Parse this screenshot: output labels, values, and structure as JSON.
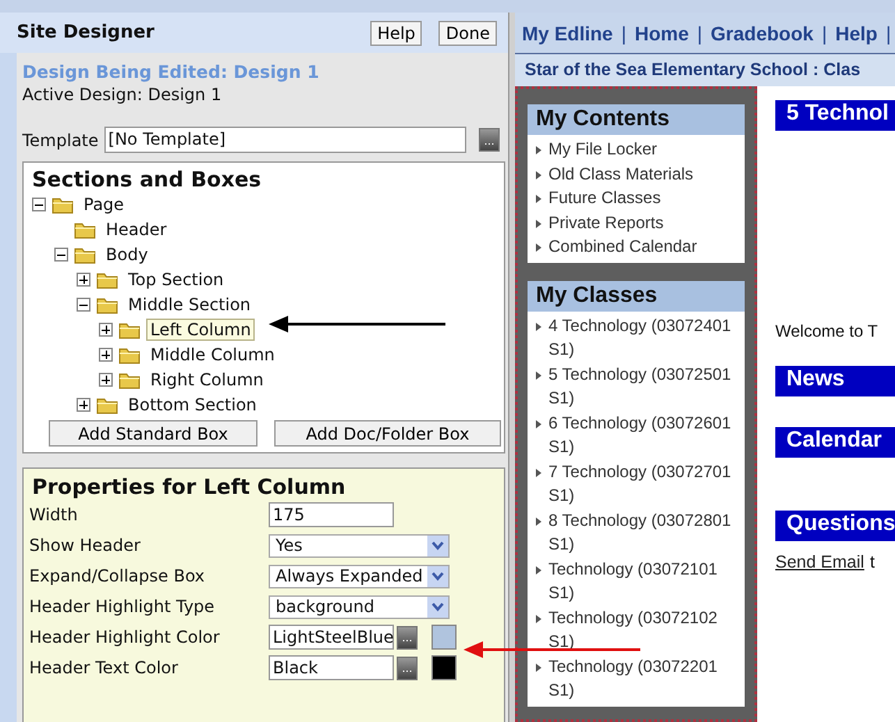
{
  "designer": {
    "title": "Site Designer",
    "buttons": [
      "Help",
      "Done"
    ],
    "design_being_edited": "Design Being Edited: Design 1",
    "active_design": "Active Design: Design 1",
    "template": {
      "label": "Template",
      "value": "[No Template]",
      "button": "..."
    },
    "sections": {
      "title": "Sections and Boxes",
      "tree": [
        {
          "label": "Page",
          "expanded": true,
          "selected": false,
          "children": [
            {
              "label": "Header",
              "selected": false
            },
            {
              "label": "Body",
              "expanded": true,
              "selected": false,
              "children": [
                {
                  "label": "Top Section",
                  "expanded": false,
                  "selected": false
                },
                {
                  "label": "Middle Section",
                  "expanded": true,
                  "selected": false,
                  "children": [
                    {
                      "label": "Left Column",
                      "expanded": false,
                      "selected": true
                    },
                    {
                      "label": "Middle Column",
                      "expanded": false,
                      "selected": false
                    },
                    {
                      "label": "Right Column",
                      "expanded": false,
                      "selected": false
                    }
                  ]
                },
                {
                  "label": "Bottom Section",
                  "expanded": false,
                  "selected": false
                }
              ]
            }
          ]
        }
      ],
      "buttons": [
        "Add Standard Box",
        "Add Doc/Folder Box"
      ]
    },
    "properties": {
      "title": "Properties for Left Column",
      "rows": [
        {
          "kind": "text",
          "label": "Width",
          "value": "175"
        },
        {
          "kind": "select",
          "label": "Show Header",
          "value": "Yes"
        },
        {
          "kind": "select",
          "label": "Expand/Collapse Box",
          "value": "Always Expanded"
        },
        {
          "kind": "select",
          "label": "Header Highlight Type",
          "value": "background"
        },
        {
          "kind": "color",
          "label": "Header Highlight Color",
          "value": "LightSteelBlue",
          "button": "...",
          "color": "#b0c4de"
        },
        {
          "kind": "color",
          "label": "Header Text Color",
          "value": "Black",
          "button": "...",
          "color": "#000000"
        }
      ]
    }
  },
  "preview": {
    "nav": [
      "My Edline",
      "|",
      "Home",
      "|",
      "Gradebook",
      "|",
      "Help",
      "|"
    ],
    "school": "Star of the Sea Elementary School : Clas",
    "boxes": [
      {
        "title": "My Contents",
        "items": [
          "My File Locker",
          "Old Class Materials",
          "Future Classes",
          "Private Reports",
          "Combined Calendar"
        ]
      },
      {
        "title": "My Classes",
        "items": [
          "4 Technology (03072401 S1)",
          "5 Technology (03072501 S1)",
          "6 Technology (03072601 S1)",
          "7 Technology (03072701 S1)",
          "8 Technology (03072801 S1)",
          "Technology (03072101 S1)",
          "Technology (03072102 S1)",
          "Technology (03072201 S1)"
        ]
      }
    ],
    "content": [
      {
        "kind": "heading",
        "text": "5 Technol"
      },
      {
        "kind": "text",
        "text": "Welcome to T"
      },
      {
        "kind": "heading",
        "text": "News"
      },
      {
        "kind": "heading",
        "text": "Calendar"
      },
      {
        "kind": "heading",
        "text": "Questions"
      },
      {
        "kind": "link",
        "text": "Send Email",
        "after": "t"
      }
    ]
  }
}
